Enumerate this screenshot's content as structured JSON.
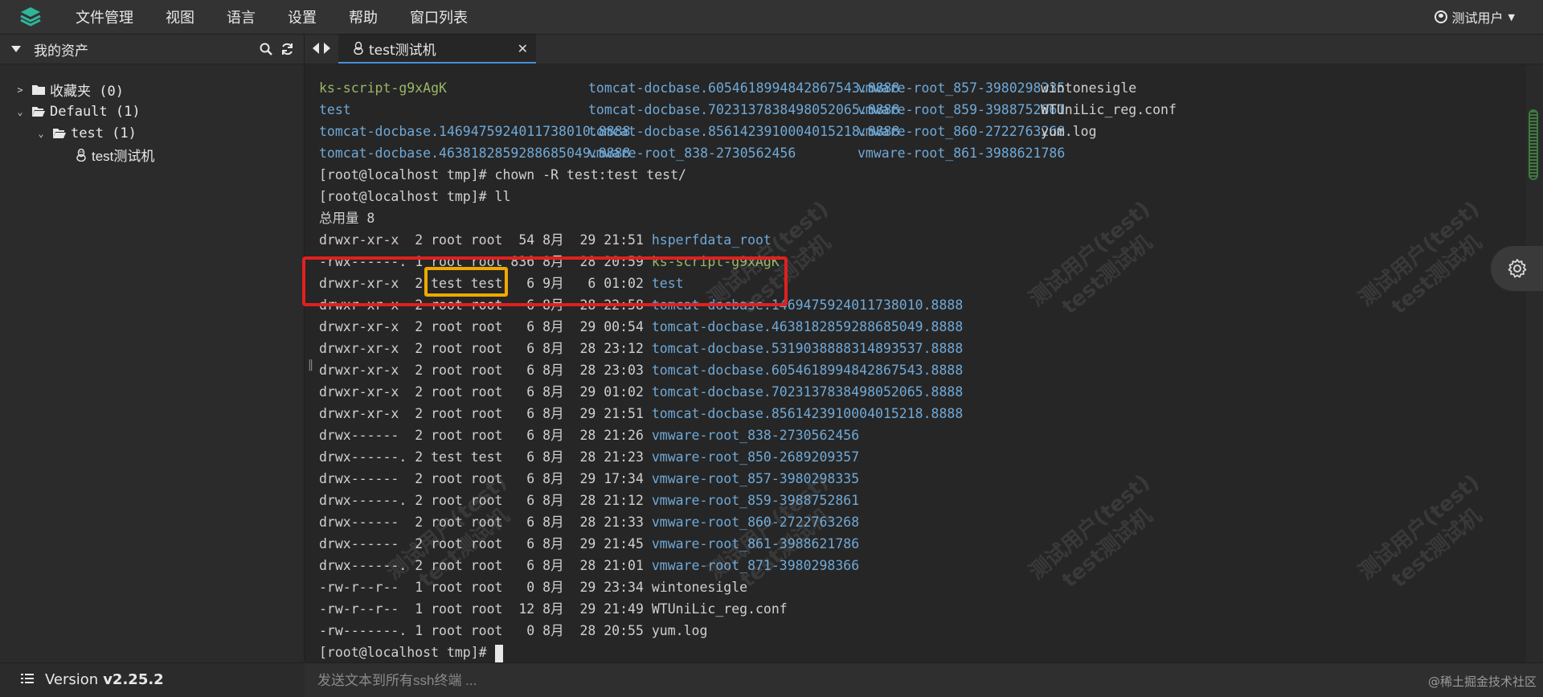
{
  "menu": {
    "items": [
      "文件管理",
      "视图",
      "语言",
      "设置",
      "帮助",
      "窗口列表"
    ]
  },
  "user": {
    "name": "测试用户"
  },
  "sidebar": {
    "title": "我的资产",
    "tree": [
      {
        "label": "收藏夹 (0)"
      },
      {
        "label": "Default (1)"
      },
      {
        "label": "test (1)"
      },
      {
        "label": "test测试机"
      }
    ]
  },
  "version": {
    "label": "Version",
    "number": "v2.25.2"
  },
  "tab": {
    "title": "test测试机"
  },
  "terminal": {
    "ls_rows": [
      [
        "ks-script-g9xAgK",
        "tomcat-docbase.6054618994842867543.8888",
        "vmware-root_857-3980298335",
        "wintonesigle"
      ],
      [
        "test",
        "tomcat-docbase.7023137838498052065.8888",
        "vmware-root_859-3988752861",
        "WTUniLic_reg.conf"
      ],
      [
        "tomcat-docbase.1469475924011738010.8888",
        "tomcat-docbase.8561423910004015218.8888",
        "vmware-root_860-2722763268",
        "yum.log"
      ],
      [
        "tomcat-docbase.4638182859288685049.8888",
        "vmware-root_838-2730562456",
        "vmware-root_861-3988621786",
        ""
      ]
    ],
    "cmd1": "[root@localhost tmp]# chown -R test:test test/",
    "cmd2": "[root@localhost tmp]# ll",
    "total": "总用量 8",
    "ll": [
      {
        "perm": "drwxr-xr-x",
        "n": "2",
        "u": "root",
        "g": "root",
        "size": "54",
        "mon": "8月",
        "day": "29",
        "time": "21:51",
        "name": "hsperfdata_root"
      },
      {
        "perm": "-rwx------.",
        "n": "1",
        "u": "root",
        "g": "root",
        "size": "836",
        "mon": "8月",
        "day": "28",
        "time": "20:59",
        "name": "ks-script-g9xAgK"
      },
      {
        "perm": "drwxr-xr-x",
        "n": "2",
        "u": "test",
        "g": "test",
        "size": "6",
        "mon": "9月",
        "day": "6",
        "time": "01:02",
        "name": "test"
      },
      {
        "perm": "drwxr-xr-x",
        "n": "2",
        "u": "root",
        "g": "root",
        "size": "6",
        "mon": "8月",
        "day": "28",
        "time": "22:58",
        "name": "tomcat-docbase.1469475924011738010.8888"
      },
      {
        "perm": "drwxr-xr-x",
        "n": "2",
        "u": "root",
        "g": "root",
        "size": "6",
        "mon": "8月",
        "day": "29",
        "time": "00:54",
        "name": "tomcat-docbase.4638182859288685049.8888"
      },
      {
        "perm": "drwxr-xr-x",
        "n": "2",
        "u": "root",
        "g": "root",
        "size": "6",
        "mon": "8月",
        "day": "28",
        "time": "23:12",
        "name": "tomcat-docbase.5319038888314893537.8888"
      },
      {
        "perm": "drwxr-xr-x",
        "n": "2",
        "u": "root",
        "g": "root",
        "size": "6",
        "mon": "8月",
        "day": "28",
        "time": "23:03",
        "name": "tomcat-docbase.6054618994842867543.8888"
      },
      {
        "perm": "drwxr-xr-x",
        "n": "2",
        "u": "root",
        "g": "root",
        "size": "6",
        "mon": "8月",
        "day": "29",
        "time": "01:02",
        "name": "tomcat-docbase.7023137838498052065.8888"
      },
      {
        "perm": "drwxr-xr-x",
        "n": "2",
        "u": "root",
        "g": "root",
        "size": "6",
        "mon": "8月",
        "day": "29",
        "time": "21:51",
        "name": "tomcat-docbase.8561423910004015218.8888"
      },
      {
        "perm": "drwx------",
        "n": "2",
        "u": "root",
        "g": "root",
        "size": "6",
        "mon": "8月",
        "day": "28",
        "time": "21:26",
        "name": "vmware-root_838-2730562456"
      },
      {
        "perm": "drwx------.",
        "n": "2",
        "u": "test",
        "g": "test",
        "size": "6",
        "mon": "8月",
        "day": "28",
        "time": "21:23",
        "name": "vmware-root_850-2689209357"
      },
      {
        "perm": "drwx------",
        "n": "2",
        "u": "root",
        "g": "root",
        "size": "6",
        "mon": "8月",
        "day": "29",
        "time": "17:34",
        "name": "vmware-root_857-3980298335"
      },
      {
        "perm": "drwx------.",
        "n": "2",
        "u": "root",
        "g": "root",
        "size": "6",
        "mon": "8月",
        "day": "28",
        "time": "21:12",
        "name": "vmware-root_859-3988752861"
      },
      {
        "perm": "drwx------",
        "n": "2",
        "u": "root",
        "g": "root",
        "size": "6",
        "mon": "8月",
        "day": "28",
        "time": "21:33",
        "name": "vmware-root_860-2722763268"
      },
      {
        "perm": "drwx------",
        "n": "2",
        "u": "root",
        "g": "root",
        "size": "6",
        "mon": "8月",
        "day": "29",
        "time": "21:45",
        "name": "vmware-root_861-3988621786"
      },
      {
        "perm": "drwx------.",
        "n": "2",
        "u": "root",
        "g": "root",
        "size": "6",
        "mon": "8月",
        "day": "28",
        "time": "21:01",
        "name": "vmware-root_871-3980298366"
      },
      {
        "perm": "-rw-r--r--",
        "n": "1",
        "u": "root",
        "g": "root",
        "size": "0",
        "mon": "8月",
        "day": "29",
        "time": "23:34",
        "name": "wintonesigle"
      },
      {
        "perm": "-rw-r--r--",
        "n": "1",
        "u": "root",
        "g": "root",
        "size": "12",
        "mon": "8月",
        "day": "29",
        "time": "21:49",
        "name": "WTUniLic_reg.conf"
      },
      {
        "perm": "-rw-------.",
        "n": "1",
        "u": "root",
        "g": "root",
        "size": "0",
        "mon": "8月",
        "day": "28",
        "time": "20:55",
        "name": "yum.log"
      }
    ],
    "prompt": "[root@localhost tmp]# "
  },
  "watermark": {
    "line1": "测试用户(test)",
    "line2": "test测试机"
  },
  "input": {
    "placeholder": "发送文本到所有ssh终端 ..."
  },
  "credit": "@稀土掘金技术社区",
  "colors": {
    "dir": "#6fa9d8",
    "exec": "#9bb568",
    "highlight_red": "#e02020",
    "highlight_orange": "#f0a800"
  }
}
